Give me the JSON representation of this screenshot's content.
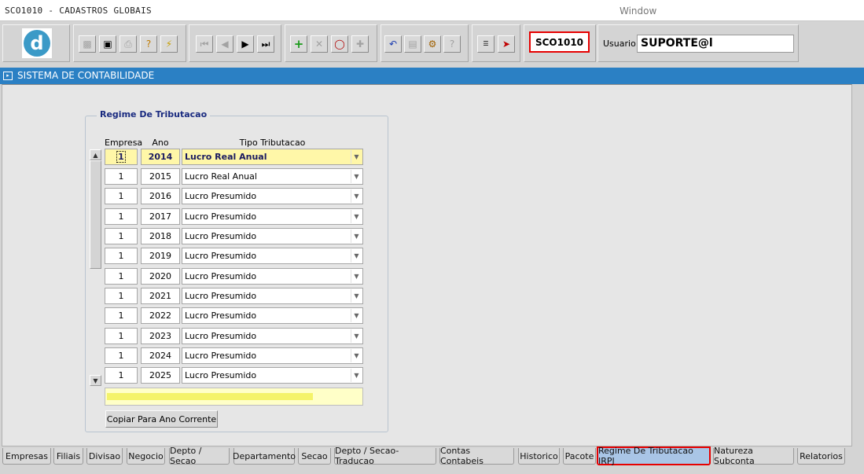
{
  "window": {
    "title": "SCO1010 - CADASTROS GLOBAIS",
    "menu": "Window"
  },
  "toolbar": {
    "module_code": "SCO1010",
    "usuario_label": "Usuario",
    "usuario_value": "SUPORTE@l",
    "icons": [
      "logo-d",
      "save-icon",
      "print-preview-icon",
      "printer-icon",
      "query-icon",
      "execute-query-icon",
      "first-record-icon",
      "previous-record-icon",
      "next-record-icon",
      "last-record-icon",
      "insert-record-icon",
      "delete-record-icon",
      "search-icon",
      "clear-icon",
      "undo-icon",
      "clipboard-icon",
      "options-icon",
      "help-icon",
      "menu-icon",
      "exit-icon"
    ]
  },
  "system_bar": {
    "title": "SISTEMA DE CONTABILIDADE"
  },
  "form": {
    "frame_title": "Regime De Tributacao",
    "columns": {
      "empresa": "Empresa",
      "ano": "Ano",
      "tipo": "Tipo Tributacao"
    },
    "rows": [
      {
        "empresa": "1",
        "ano": "2014",
        "tipo": "Lucro Real Anual"
      },
      {
        "empresa": "1",
        "ano": "2015",
        "tipo": "Lucro Real Anual"
      },
      {
        "empresa": "1",
        "ano": "2016",
        "tipo": "Lucro Presumido"
      },
      {
        "empresa": "1",
        "ano": "2017",
        "tipo": "Lucro Presumido"
      },
      {
        "empresa": "1",
        "ano": "2018",
        "tipo": "Lucro Presumido"
      },
      {
        "empresa": "1",
        "ano": "2019",
        "tipo": "Lucro Presumido"
      },
      {
        "empresa": "1",
        "ano": "2020",
        "tipo": "Lucro Presumido"
      },
      {
        "empresa": "1",
        "ano": "2021",
        "tipo": "Lucro Presumido"
      },
      {
        "empresa": "1",
        "ano": "2022",
        "tipo": "Lucro Presumido"
      },
      {
        "empresa": "1",
        "ano": "2023",
        "tipo": "Lucro Presumido"
      },
      {
        "empresa": "1",
        "ano": "2024",
        "tipo": "Lucro Presumido"
      },
      {
        "empresa": "1",
        "ano": "2025",
        "tipo": "Lucro Presumido"
      }
    ],
    "copy_button": "Copiar Para Ano Corrente"
  },
  "tabs": [
    "Empresas",
    "Filiais",
    "Divisao",
    "Negocio",
    "Depto / Secao",
    "Departamento",
    "Secao",
    "Depto / Secao-Traducao",
    "Contas Contabeis",
    "Historico",
    "Pacote",
    "Regime De Tributacao IRPJ",
    "Natureza Subconta",
    "Relatorios"
  ],
  "active_tab": "Regime De Tributacao IRPJ",
  "colors": {
    "accent": "#2b80c4",
    "highlight_border": "#e60000",
    "selected_row": "#fff7a8"
  }
}
